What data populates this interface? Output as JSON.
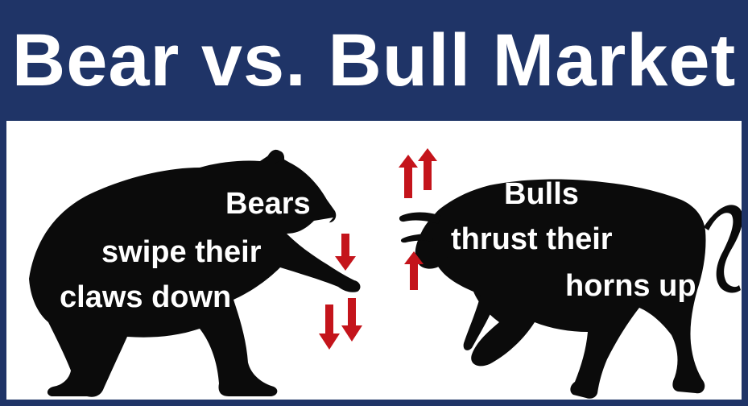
{
  "title": "Bear vs. Bull Market",
  "bear": {
    "line1": "Bears",
    "line2": "swipe their",
    "line3": "claws down"
  },
  "bull": {
    "line1": "Bulls",
    "line2": "thrust their",
    "line3": "horns up"
  },
  "colors": {
    "navy": "#1f3467",
    "silhouette": "#0b0b0b",
    "arrow_red": "#c4141b",
    "white": "#ffffff"
  },
  "icons": {
    "bear": "bear-silhouette-icon",
    "bull": "bull-silhouette-icon",
    "down_arrows": "red-down-arrow-icon",
    "up_arrows": "red-up-arrow-icon"
  }
}
